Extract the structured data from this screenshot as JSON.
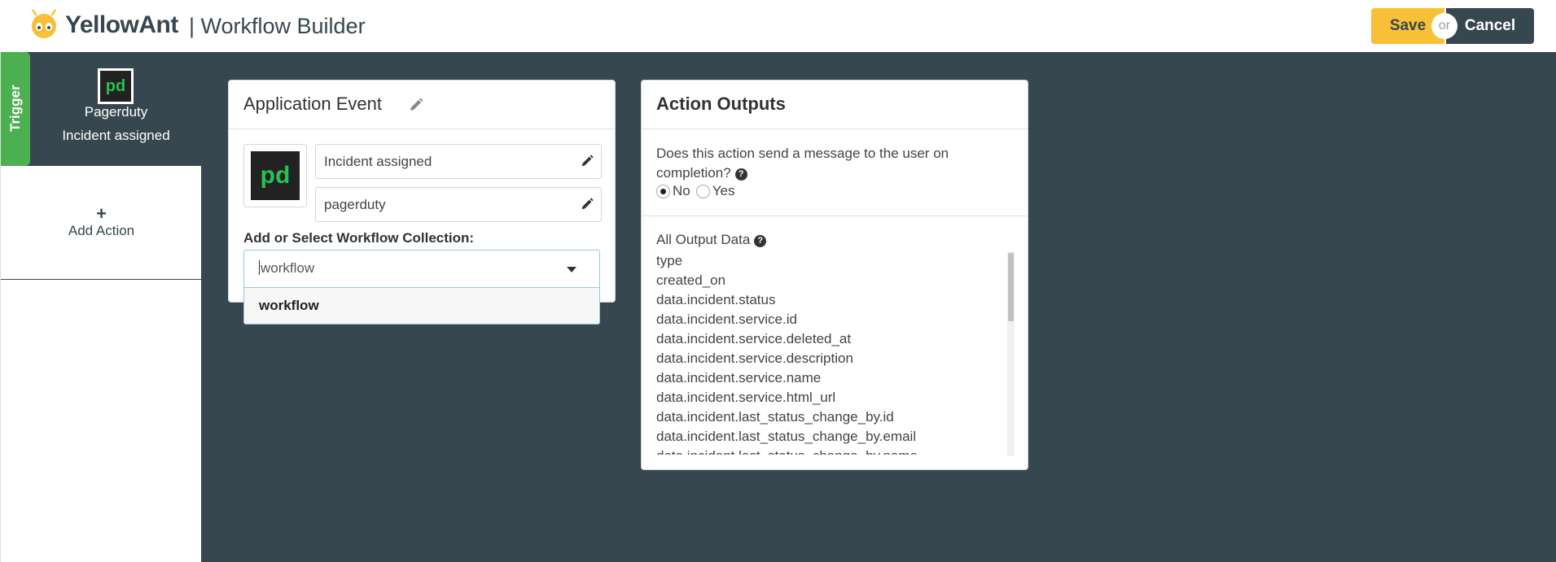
{
  "header": {
    "brand": "YellowAnt",
    "page_title": "| Workflow Builder",
    "save_label": "Save",
    "or_label": "or",
    "cancel_label": "Cancel"
  },
  "sidebar": {
    "trigger_tab": "Trigger",
    "trigger_app": "Pagerduty",
    "trigger_event": "Incident assigned",
    "add_action_label": "Add Action",
    "add_action_icon": "+"
  },
  "event_card": {
    "title": "Application Event",
    "event_name": "Incident assigned",
    "app_name": "pagerduty",
    "collection_label": "Add or Select Workflow Collection:",
    "collection_value": "workflow",
    "dropdown_option": "workflow"
  },
  "outputs_card": {
    "title": "Action Outputs",
    "question": "Does this action send a message to the user on completion?",
    "radio_no": "No",
    "radio_yes": "Yes",
    "selected": "No",
    "output_title": "All Output Data",
    "items": [
      "type",
      "created_on",
      "data.incident.status",
      "data.incident.service.id",
      "data.incident.service.deleted_at",
      "data.incident.service.description",
      "data.incident.service.name",
      "data.incident.service.html_url",
      "data.incident.last_status_change_by.id",
      "data.incident.last_status_change_by.email",
      "data.incident.last_status_change_by.name"
    ]
  },
  "colors": {
    "brand_yellow": "#f7c038",
    "dark_slate": "#37474f",
    "trigger_green": "#4caf50",
    "pagerduty_green": "#25c151"
  }
}
